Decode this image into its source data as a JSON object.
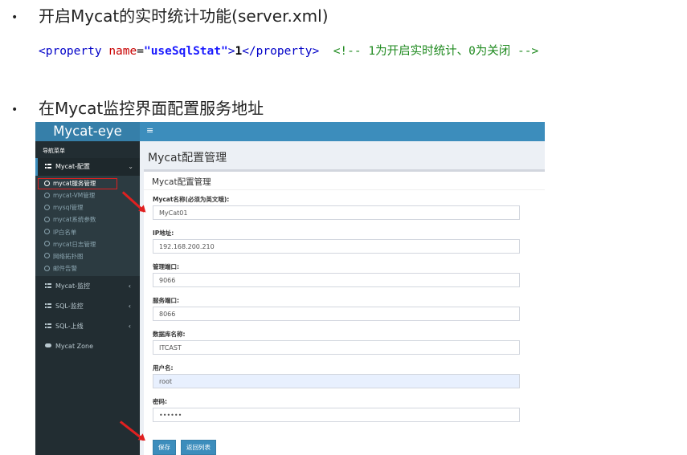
{
  "bullets": {
    "first": "开启Mycat的实时统计功能(server.xml)",
    "second": "在Mycat监控界面配置服务地址",
    "bullet_char": "•"
  },
  "code": {
    "open_tag": "<property ",
    "attr_name": "name",
    "equals": "=",
    "attr_value": "\"useSqlStat\"",
    "close_bracket": ">",
    "inner_value": "1",
    "end_tag": "</property>",
    "comment": "<!-- 1为开启实时统计、0为关闭 -->"
  },
  "app": {
    "logo": "Mycat-eye",
    "hamburger": "≡",
    "nav_header": "导航菜单",
    "menu_config": {
      "label": "Mycat-配置",
      "chevron": "⌄"
    },
    "submenu": [
      {
        "label": "mycat服务管理",
        "active": true
      },
      {
        "label": "mycat-VM管理"
      },
      {
        "label": "mysql管理"
      },
      {
        "label": "mycat系统参数"
      },
      {
        "label": "IP白名单"
      },
      {
        "label": "mycat日志管理"
      },
      {
        "label": "网络拓扑图"
      },
      {
        "label": "邮件告警"
      }
    ],
    "menus": [
      {
        "label": "Mycat-监控",
        "chevron": "‹"
      },
      {
        "label": "SQL-监控",
        "chevron": "‹"
      },
      {
        "label": "SQL-上线",
        "chevron": "‹"
      },
      {
        "label": "Mycat Zone"
      }
    ],
    "page_title": "Mycat配置管理",
    "box_title": "Mycat配置管理",
    "fields": [
      {
        "label": "Mycat名称(必须为英文哦):",
        "value": "MyCat01"
      },
      {
        "label": "IP地址:",
        "value": "192.168.200.210"
      },
      {
        "label": "管理端口:",
        "value": "9066"
      },
      {
        "label": "服务端口:",
        "value": "8066"
      },
      {
        "label": "数据库名称:",
        "value": "ITCAST"
      },
      {
        "label": "用户名:",
        "value": "root"
      },
      {
        "label": "密码:",
        "value": "••••••"
      }
    ],
    "buttons": {
      "save": "保存",
      "back": "返回列表"
    },
    "colors": {
      "header": "#3c8dbc",
      "sidebar": "#222d32",
      "highlight": "#e02020",
      "button": "#3c8dbc"
    }
  }
}
